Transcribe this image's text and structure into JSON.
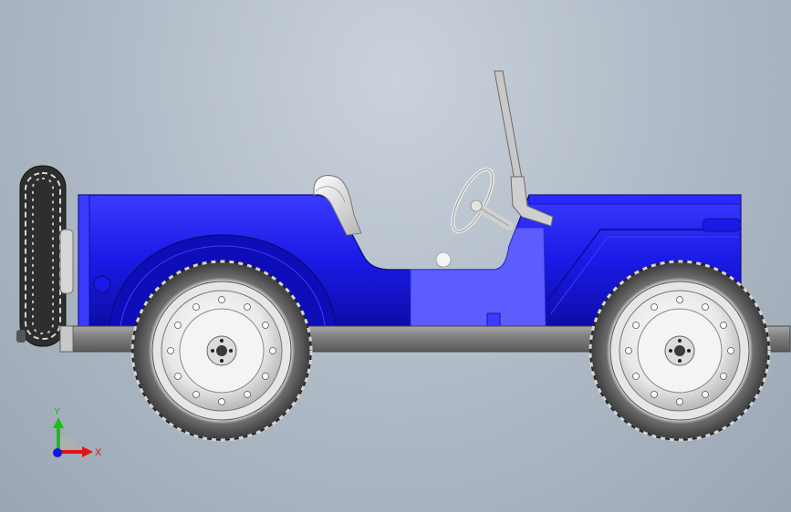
{
  "viewport": {
    "background_top": "#c9d2dc",
    "background_bottom": "#9aa6b4"
  },
  "model": {
    "body_color": "#1a1ae6",
    "body_dark": "#0f0fb0",
    "body_light": "#4a4aff",
    "chassis_color": "#7d7d7d",
    "tire_color": "#4a4a4a",
    "rim_color": "#f2f2f2"
  },
  "triad": {
    "y_label": "Y",
    "x_label": "X",
    "y_color": "#1bbf1b",
    "x_color": "#e01414",
    "z_color": "#1414e0"
  }
}
